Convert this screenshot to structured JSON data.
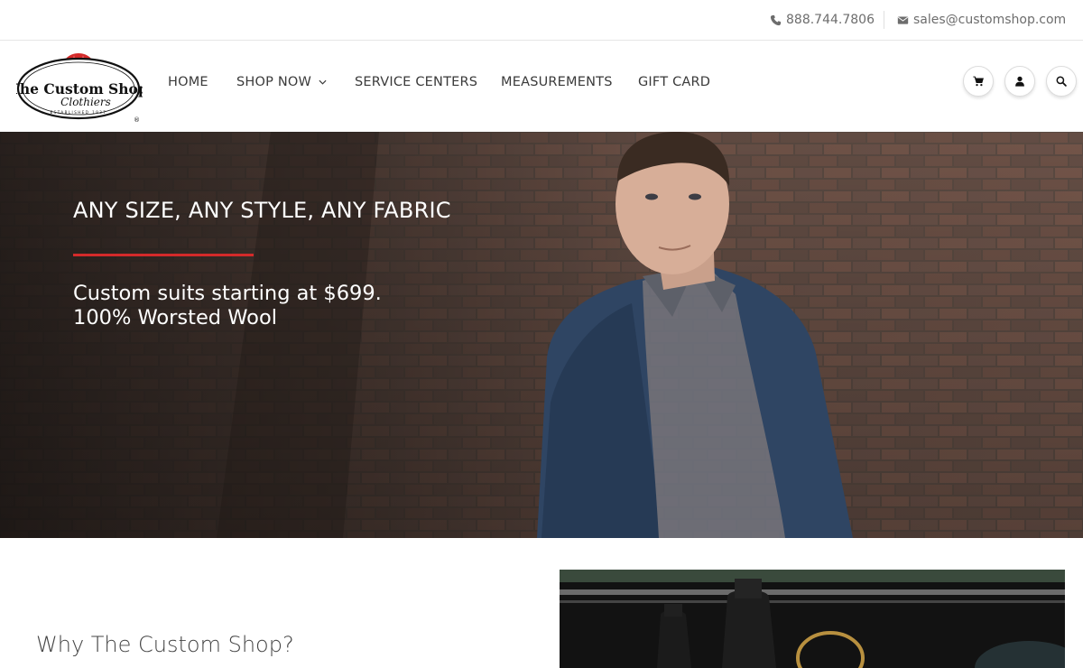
{
  "topbar": {
    "phone": "888.744.7806",
    "email": "sales@customshop.com",
    "phone_icon": "phone-icon",
    "email_icon": "envelope-icon"
  },
  "brand": {
    "logo_line1": "The Custom Shop",
    "logo_line2": "Clothiers",
    "logo_established": "ESTABLISHED 1937",
    "logo_mark": "®",
    "accent_color": "#d42a2a"
  },
  "nav": {
    "items": [
      {
        "label": "HOME"
      },
      {
        "label": "SHOP NOW",
        "has_dropdown": true
      },
      {
        "label": "SERVICE CENTERS"
      },
      {
        "label": "MEASUREMENTS"
      },
      {
        "label": "GIFT CARD"
      }
    ]
  },
  "header_buttons": {
    "cart_icon": "cart-icon",
    "account_icon": "user-icon",
    "search_icon": "search-icon"
  },
  "hero": {
    "headline": "ANY SIZE, ANY STYLE, ANY FABRIC",
    "sub_line1": "Custom suits starting at $699.",
    "sub_line2": "100% Worsted Wool"
  },
  "section": {
    "title": "Why The Custom Shop?"
  }
}
